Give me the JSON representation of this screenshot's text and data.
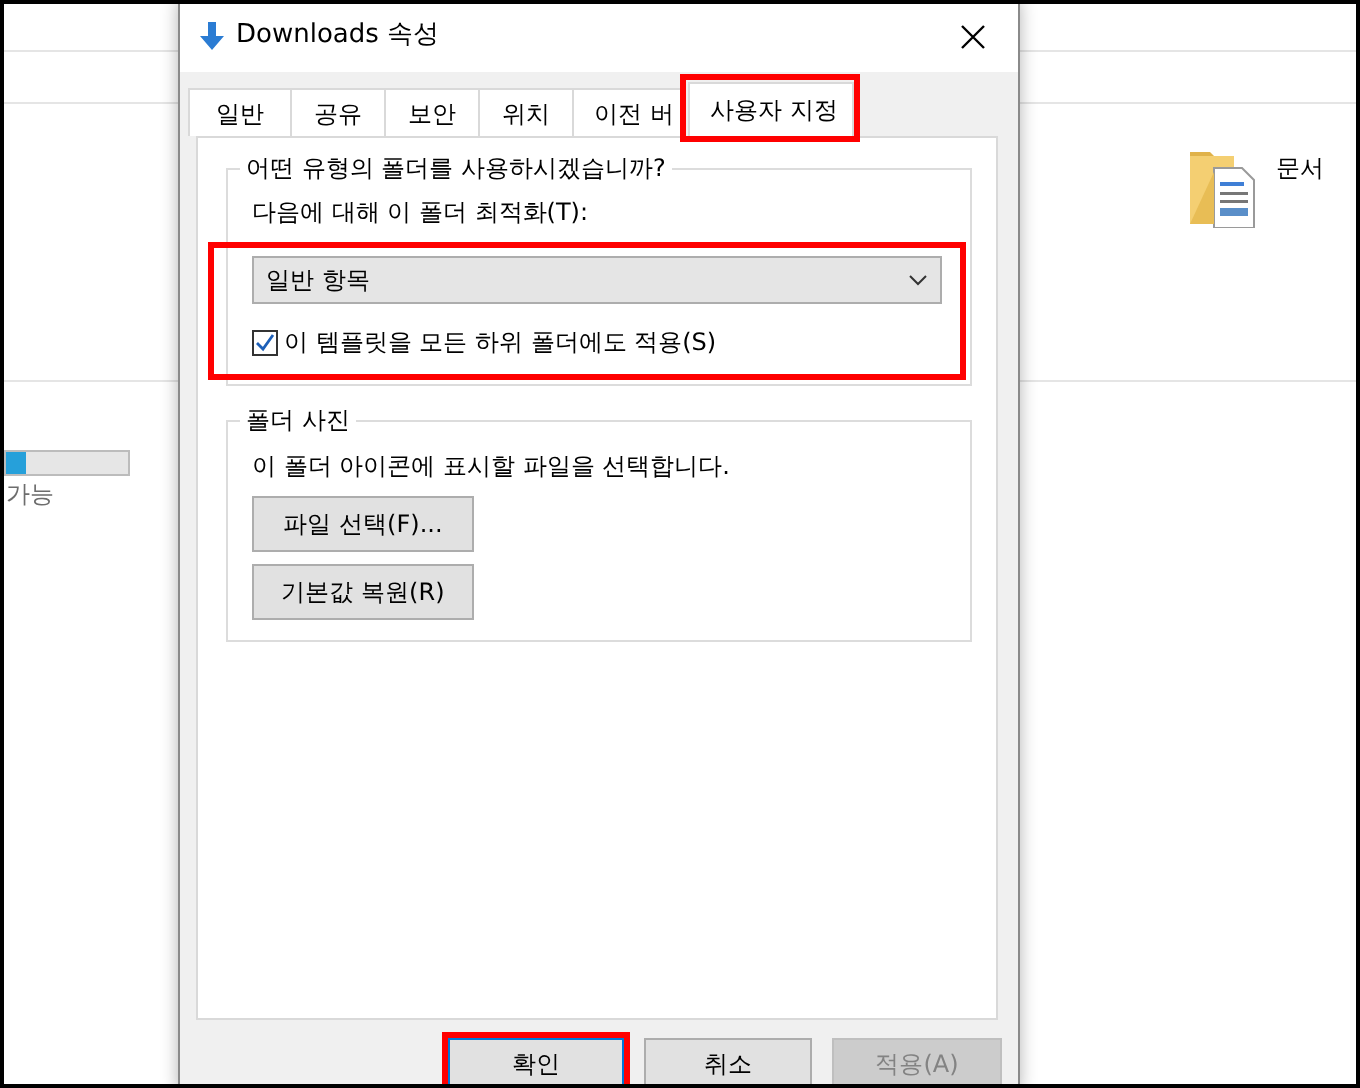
{
  "explorer": {
    "storage": {
      "level": 0.16
    },
    "storage_caption": "가능",
    "folder": {
      "label": "문서"
    }
  },
  "dialog": {
    "title": "Downloads 속성",
    "tabs": [
      {
        "label": "일반",
        "selected": false,
        "highlighted": false
      },
      {
        "label": "공유",
        "selected": false,
        "highlighted": false
      },
      {
        "label": "보안",
        "selected": false,
        "highlighted": false
      },
      {
        "label": "위치",
        "selected": false,
        "highlighted": false
      },
      {
        "label": "이전 버",
        "selected": false,
        "highlighted": false
      },
      {
        "label": "사용자 지정",
        "selected": true,
        "highlighted": true
      }
    ],
    "folder_type_group": {
      "legend": "어떤 유형의 폴더를 사용하시겠습니까?",
      "highlighted": true,
      "optimize_label": "다음에 대해 이 폴더 최적화(T):",
      "optimize_value": "일반 항목",
      "apply_to_subfolders": {
        "label": "이 템플릿을 모든 하위 폴더에도 적용(S)",
        "checked": true
      }
    },
    "folder_picture_group": {
      "legend": "폴더 사진",
      "description": "이 폴더 아이콘에 표시할 파일을 선택합니다.",
      "buttons": [
        {
          "label": "파일 선택(F)..."
        },
        {
          "label": "기본값 복원(R)"
        }
      ]
    },
    "buttons": [
      {
        "label": "확인",
        "kind": "default",
        "disabled": false,
        "highlighted": true
      },
      {
        "label": "취소",
        "kind": "normal",
        "disabled": false,
        "highlighted": false
      },
      {
        "label": "적용(A)",
        "kind": "normal",
        "disabled": true,
        "highlighted": false
      }
    ]
  }
}
